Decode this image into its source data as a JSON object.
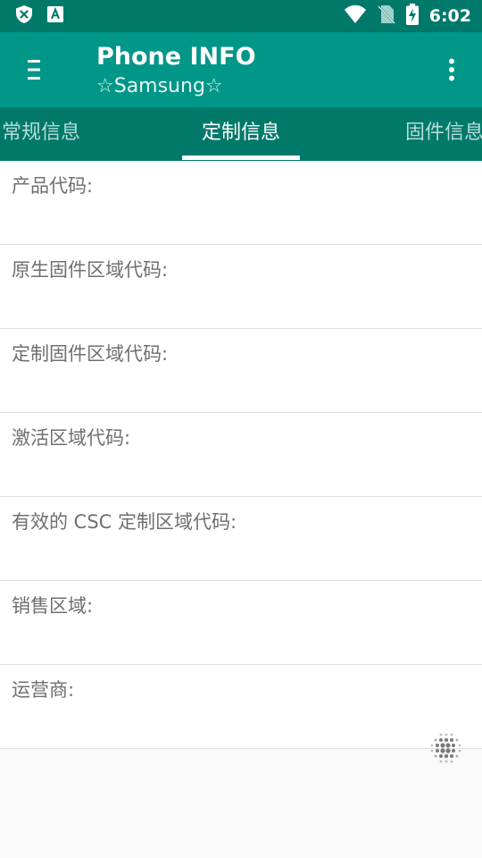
{
  "status_bar": {
    "time": "6:02",
    "icons": [
      "shield-x-icon",
      "font-a-icon",
      "wifi-icon",
      "no-sim-icon",
      "battery-charging-icon"
    ]
  },
  "app_bar": {
    "title": "Phone INFO",
    "subtitle": "☆Samsung☆",
    "menu_icon": "hamburger-menu-icon",
    "overflow_icon": "more-vert-icon"
  },
  "tabs": [
    {
      "label": "常规信息",
      "active": false
    },
    {
      "label": "定制信息",
      "active": true
    },
    {
      "label": "固件信息",
      "active": false
    }
  ],
  "rows": [
    {
      "label": "产品代码:",
      "value": ""
    },
    {
      "label": "原生固件区域代码:",
      "value": ""
    },
    {
      "label": "定制固件区域代码:",
      "value": ""
    },
    {
      "label": "激活区域代码:",
      "value": ""
    },
    {
      "label": "有效的 CSC 定制区域代码:",
      "value": ""
    },
    {
      "label": "销售区域:",
      "value": ""
    },
    {
      "label": "运营商:",
      "value": ""
    }
  ],
  "colors": {
    "primary": "#009688",
    "primary_dark": "#00796b",
    "label_text": "#6f6f6f"
  }
}
